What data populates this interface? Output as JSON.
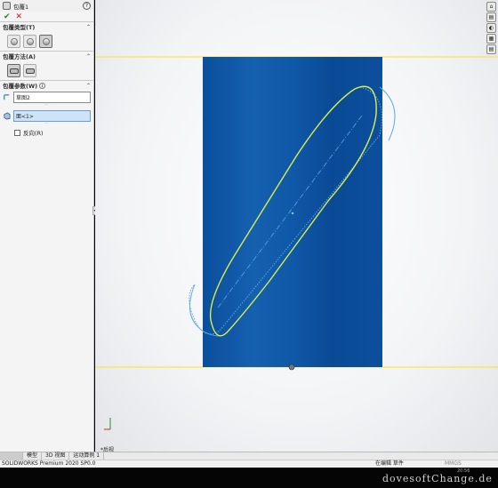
{
  "panel": {
    "feature_title": "包覆1",
    "help_glyph": "?",
    "ok_glyph": "✔",
    "cancel_glyph": "✕",
    "sections": {
      "wrap_type": "包覆类型(T)",
      "wrap_method": "包覆方法(A)",
      "wrap_params": "包覆参数(W)"
    },
    "params": {
      "sketch_value": "草图2",
      "face_value": "面<1>",
      "reverse_label": "反向(R)"
    },
    "collapse_glyph": "◂"
  },
  "viewport": {
    "view_label": "*后视",
    "triad_glyph": "↑"
  },
  "taskpane": [
    "⌂",
    "▤",
    "◐",
    "▦",
    "▤"
  ],
  "tabs": [
    "",
    "模型",
    "3D 视图",
    "运动算例 1"
  ],
  "status": {
    "left": "SOLIDWORKS Premium 2020 SP0.0",
    "right": "在编辑 草件",
    "unit": "MMGS",
    "extra": "⌂"
  },
  "watermark": "dovesoftChange.de",
  "clock": "20:56",
  "colors": {
    "cylinder": "#0d56a6",
    "edge_line": "#f2e84a",
    "slot_outline": "#d6f04a",
    "construction": "#5ca8e6"
  }
}
